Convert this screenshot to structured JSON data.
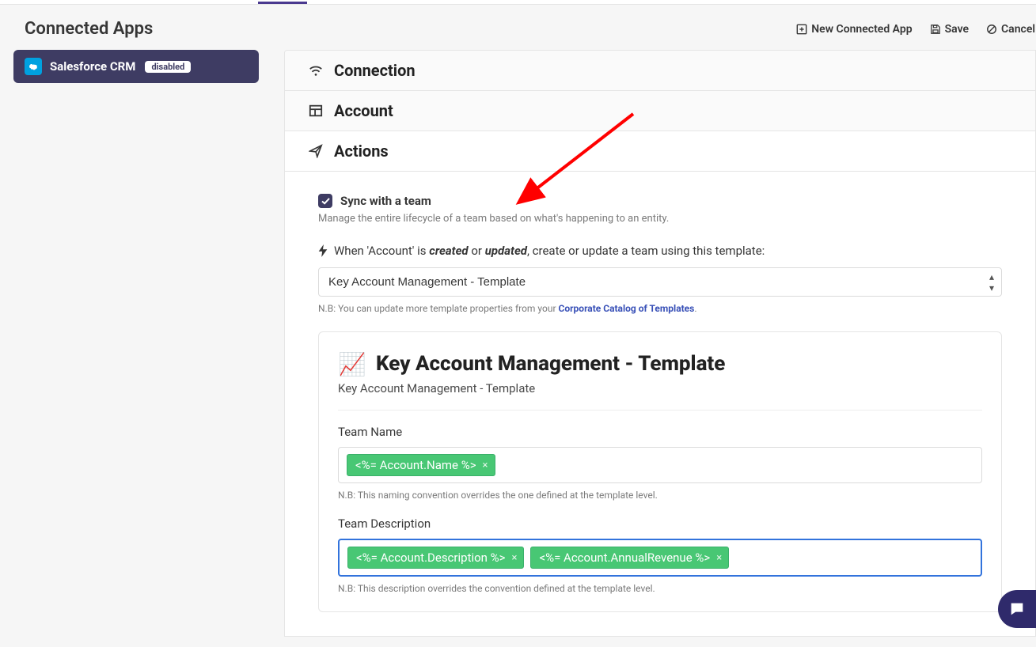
{
  "header": {
    "title": "Connected Apps",
    "actions": {
      "new": "New Connected App",
      "save": "Save",
      "cancel": "Cancel"
    }
  },
  "sidebar": {
    "items": [
      {
        "label": "Salesforce CRM",
        "badge": "disabled"
      }
    ]
  },
  "panels": {
    "connection": "Connection",
    "account": "Account",
    "actions": "Actions"
  },
  "actions_section": {
    "checkbox_label": "Sync with a team",
    "checkbox_help": "Manage the entire lifecycle of a team based on what's happening to an entity.",
    "rule_prefix": "When 'Account' is ",
    "rule_created": "created",
    "rule_or": " or ",
    "rule_updated": "updated",
    "rule_suffix": ", create or update a team using this template:",
    "template_select": "Key Account Management - Template",
    "nb_prefix": "N.B: You can update more template properties from your ",
    "nb_link": "Corporate Catalog of Templates",
    "nb_suffix": "."
  },
  "template_card": {
    "title": "Key Account Management - Template",
    "subtitle": "Key Account Management - Template",
    "team_name_label": "Team Name",
    "team_name_tokens": [
      "<%= Account.Name %>"
    ],
    "team_name_nb": "N.B: This naming convention overrides the one defined at the template level.",
    "team_desc_label": "Team Description",
    "team_desc_tokens": [
      "<%= Account.Description %>",
      "<%= Account.AnnualRevenue %>"
    ],
    "team_desc_nb": "N.B: This description overrides the convention defined at the template level."
  }
}
